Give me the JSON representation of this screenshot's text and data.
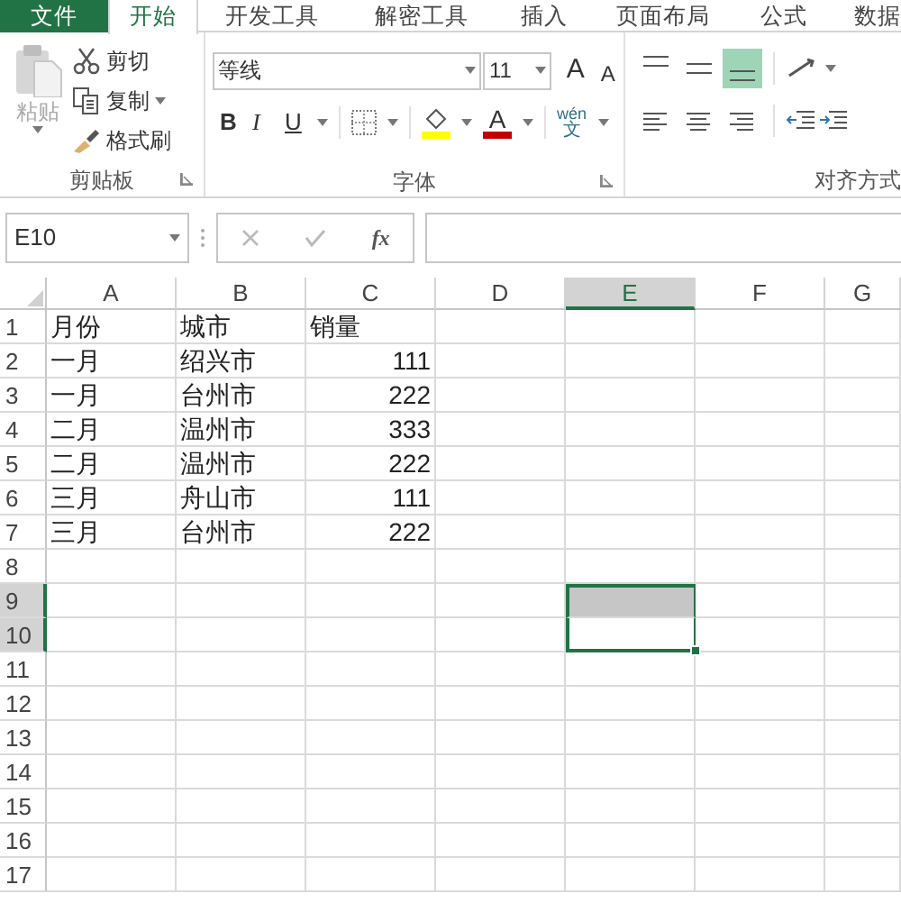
{
  "tabs": [
    {
      "label": "文件",
      "kind": "file",
      "selected": false
    },
    {
      "label": "开始",
      "kind": "tab",
      "selected": true
    },
    {
      "label": "开发工具",
      "kind": "tab",
      "selected": false
    },
    {
      "label": "解密工具",
      "kind": "tab",
      "selected": false
    },
    {
      "label": "插入",
      "kind": "tab",
      "selected": false
    },
    {
      "label": "页面布局",
      "kind": "tab",
      "selected": false
    },
    {
      "label": "公式",
      "kind": "tab",
      "selected": false
    },
    {
      "label": "数据",
      "kind": "tab",
      "selected": false
    }
  ],
  "clipboard": {
    "paste": "粘贴",
    "cut": "剪切",
    "copy": "复制",
    "format_painter": "格式刷",
    "label": "剪贴板"
  },
  "font": {
    "name": "等线",
    "size": "11",
    "grow": "A",
    "shrink": "A",
    "bold": "B",
    "italic": "I",
    "underline": "U",
    "font_color": "A",
    "phonetic_top": "wén",
    "phonetic_bottom": "文",
    "label": "字体"
  },
  "alignment": {
    "vertical": [
      {
        "kind": "top",
        "selected": false
      },
      {
        "kind": "middle",
        "selected": false
      },
      {
        "kind": "bottom",
        "selected": true
      }
    ],
    "horizontal": [
      {
        "kind": "left"
      },
      {
        "kind": "center"
      },
      {
        "kind": "right"
      }
    ],
    "label": "对齐方式"
  },
  "formula_bar": {
    "name_box": "E10",
    "function_button": "fx"
  },
  "columns": [
    {
      "label": "A",
      "selected": false
    },
    {
      "label": "B",
      "selected": false
    },
    {
      "label": "C",
      "selected": false
    },
    {
      "label": "D",
      "selected": false
    },
    {
      "label": "E",
      "selected": true
    },
    {
      "label": "F",
      "selected": false
    },
    {
      "label": "G",
      "selected": false
    }
  ],
  "rows": [
    {
      "number": "1",
      "selected": false,
      "cells": [
        {
          "text": "月份",
          "kind": "text"
        },
        {
          "text": "城市",
          "kind": "text"
        },
        {
          "text": "销量",
          "kind": "text"
        }
      ]
    },
    {
      "number": "2",
      "selected": false,
      "cells": [
        {
          "text": "一月",
          "kind": "text"
        },
        {
          "text": "绍兴市",
          "kind": "text"
        },
        {
          "text": "111",
          "kind": "number"
        }
      ]
    },
    {
      "number": "3",
      "selected": false,
      "cells": [
        {
          "text": "一月",
          "kind": "text"
        },
        {
          "text": "台州市",
          "kind": "text"
        },
        {
          "text": "222",
          "kind": "number"
        }
      ]
    },
    {
      "number": "4",
      "selected": false,
      "cells": [
        {
          "text": "二月",
          "kind": "text"
        },
        {
          "text": "温州市",
          "kind": "text"
        },
        {
          "text": "333",
          "kind": "number"
        }
      ]
    },
    {
      "number": "5",
      "selected": false,
      "cells": [
        {
          "text": "二月",
          "kind": "text"
        },
        {
          "text": "温州市",
          "kind": "text"
        },
        {
          "text": "222",
          "kind": "number"
        }
      ]
    },
    {
      "number": "6",
      "selected": false,
      "cells": [
        {
          "text": "三月",
          "kind": "text"
        },
        {
          "text": "舟山市",
          "kind": "text"
        },
        {
          "text": "111",
          "kind": "number"
        }
      ]
    },
    {
      "number": "7",
      "selected": false,
      "cells": [
        {
          "text": "三月",
          "kind": "text"
        },
        {
          "text": "台州市",
          "kind": "text"
        },
        {
          "text": "222",
          "kind": "number"
        }
      ]
    },
    {
      "number": "8",
      "selected": false,
      "cells": []
    },
    {
      "number": "9",
      "selected": true,
      "active": false,
      "cells": []
    },
    {
      "number": "10",
      "selected": true,
      "active": true,
      "cells": []
    },
    {
      "number": "11",
      "selected": false,
      "cells": []
    },
    {
      "number": "12",
      "selected": false,
      "cells": []
    },
    {
      "number": "13",
      "selected": false,
      "cells": []
    },
    {
      "number": "14",
      "selected": false,
      "cells": []
    },
    {
      "number": "15",
      "selected": false,
      "cells": []
    },
    {
      "number": "16",
      "selected": false,
      "cells": []
    },
    {
      "number": "17",
      "selected": false,
      "cells": []
    }
  ]
}
